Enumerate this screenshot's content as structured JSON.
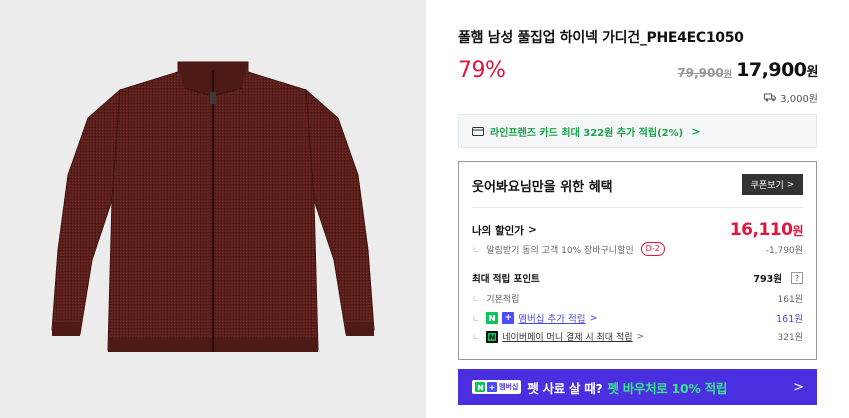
{
  "product": {
    "title": "폴햄 남성 풀집업 하이넥 가디건_PHE4EC1050",
    "discount_rate": "79%",
    "original_price": "79,900",
    "original_unit": "원",
    "sale_price": "17,900",
    "sale_unit": "원",
    "shipping_fee": "3,000원"
  },
  "card_promo": {
    "text": "라인프렌즈 카드 최대 322원 추가 적립(2%)",
    "chevron": ">"
  },
  "benefit": {
    "title": "웃어봐요님만을 위한 혜택",
    "coupon_button": "쿠폰보기",
    "coupon_chevron": ">",
    "my_price_label": "나의 할인가",
    "my_price_chevron": ">",
    "my_price": "16,110",
    "my_price_unit": "원",
    "alarm_discount_label": "알림받기 동의 고객 10% 장바구니할인",
    "alarm_discount_badge": "D-2",
    "alarm_discount_value": "-1,790원",
    "max_points_label": "최대 적립 포인트",
    "max_points_value": "793원",
    "help_icon_text": "?",
    "points": [
      {
        "label": "기본적립",
        "value": "161원"
      },
      {
        "label": "멤버십 추가 적립",
        "value": "161원",
        "icon": "naver-plus-icon"
      },
      {
        "label": "네이버페이 머니 결제 시 최대 적립",
        "value": "321원",
        "icon": "naver-pay-icon"
      }
    ],
    "elbow": "ㄴ"
  },
  "banner": {
    "badge_text": "멤버십",
    "text_plain": "펫 사료 살 때?",
    "text_highlight": "펫 바우처로 10% 적립",
    "chevron": ">"
  },
  "colors": {
    "accent_red": "#e1163c",
    "naver_green": "#03c75a",
    "membership_purple": "#4a2fe0",
    "promo_green": "#1aa34a"
  }
}
